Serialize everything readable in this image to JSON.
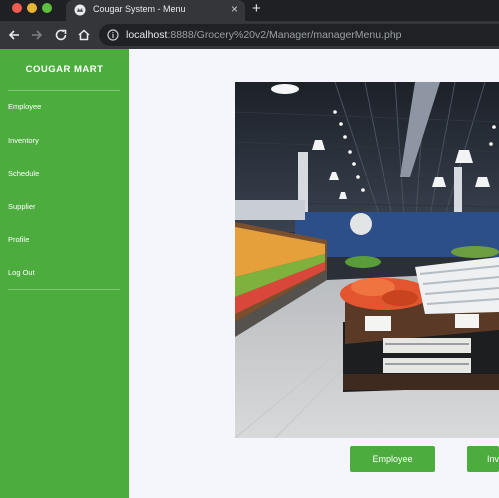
{
  "browser": {
    "tab_title": "Cougar System - Menu",
    "tab_close": "×",
    "new_tab": "+",
    "url_host": "localhost",
    "url_rest": ":8888/Grocery%20v2/Manager/managerMenu.php"
  },
  "sidebar": {
    "brand": "COUGAR MART",
    "items": [
      {
        "label": "Employee"
      },
      {
        "label": "Inventory"
      },
      {
        "label": "Schedule"
      },
      {
        "label": "Supplier"
      },
      {
        "label": "Profile"
      },
      {
        "label": "Log Out"
      }
    ]
  },
  "main": {
    "buttons": [
      {
        "label": "Employee"
      },
      {
        "label": "Inventory"
      }
    ]
  },
  "colors": {
    "sidebar_green": "#4cad3e",
    "page_bg": "#f5f6fb",
    "chrome_dark": "#35363a"
  }
}
